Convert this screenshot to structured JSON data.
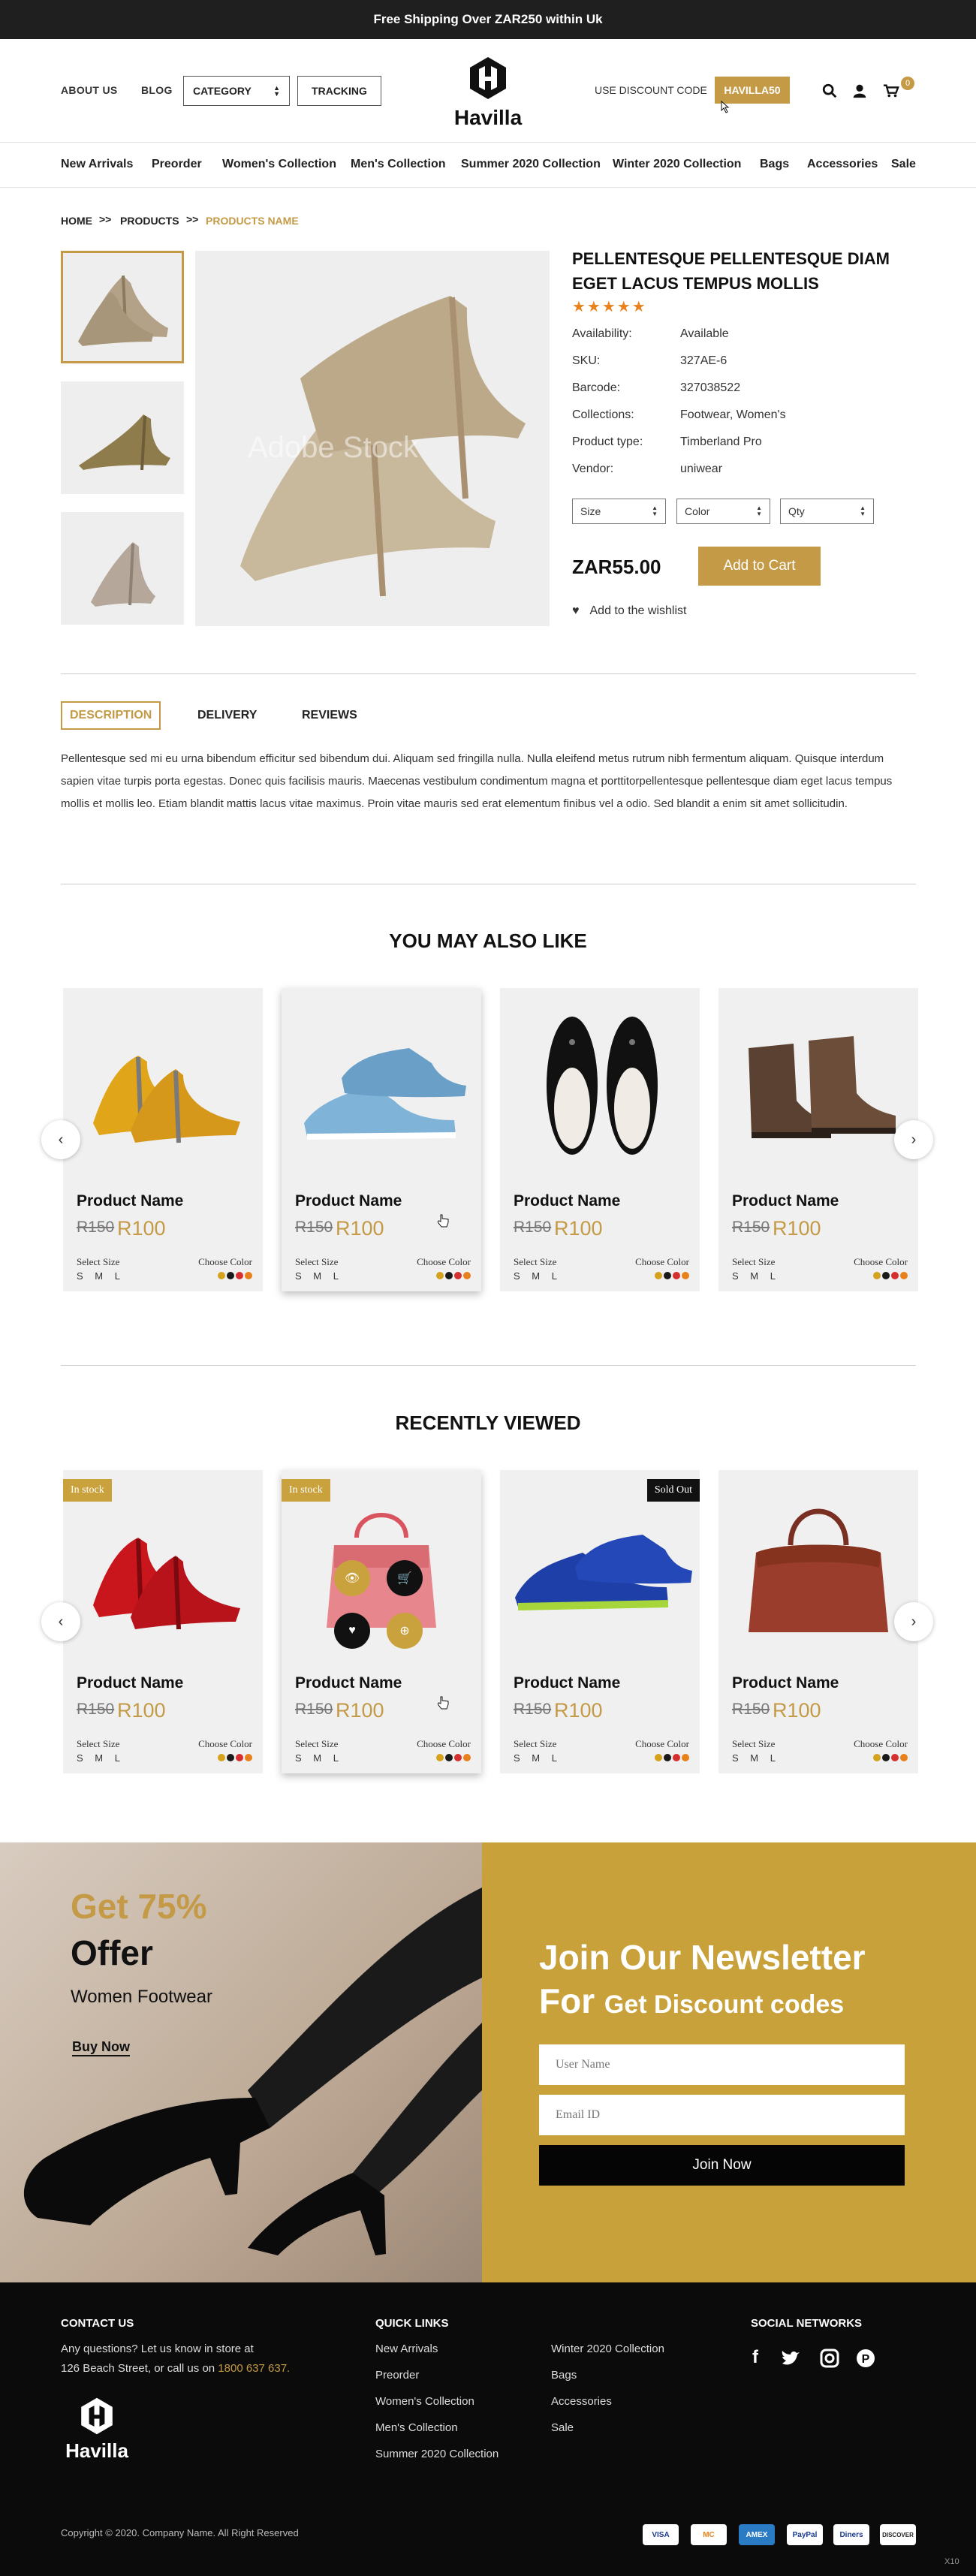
{
  "topbar": {
    "text": "Free Shipping Over ZAR250 within Uk"
  },
  "header": {
    "about": "ABOUT US",
    "blog": "BLOG",
    "category": "CATEGORY",
    "tracking": "TRACKING",
    "logo": "Havilla",
    "discount_label": "USE DISCOUNT CODE",
    "discount_code": "HAVILLA50",
    "cart_count": "0"
  },
  "nav": [
    "New Arrivals",
    "Preorder",
    "Women's Collection",
    "Men's Collection",
    "Summer 2020 Collection",
    "Winter 2020 Collection",
    "Bags",
    "Accessories",
    "Sale"
  ],
  "breadcrumb": {
    "home": "HOME",
    "products": "PRODUCTS",
    "current": "PRODUCTS NAME",
    "sep": ">>"
  },
  "product": {
    "title": "PELLENTESQUE PELLENTESQUE DIAM EGET LACUS TEMPUS MOLLIS",
    "stars": "★★★★★",
    "attrs": [
      {
        "k": "Availability:",
        "v": "Available"
      },
      {
        "k": "SKU:",
        "v": "327AE-6"
      },
      {
        "k": "Barcode:",
        "v": "327038522"
      },
      {
        "k": "Collections:",
        "v": "Footwear, Women's"
      },
      {
        "k": "Product type:",
        "v": "Timberland Pro"
      },
      {
        "k": "Vendor:",
        "v": "uniwear"
      }
    ],
    "size": "Size",
    "color": "Color",
    "qty": "Qty",
    "price": "ZAR55.00",
    "add_to_cart": "Add to Cart",
    "wishlist": "Add to the wishlist",
    "watermark": "Adobe Stock"
  },
  "tabs": {
    "description": "DESCRIPTION",
    "delivery": "DELIVERY",
    "reviews": "REVIEWS"
  },
  "description": "Pellentesque sed mi eu urna bibendum efficitur sed bibendum dui. Aliquam sed fringilla nulla. Nulla eleifend metus rutrum nibh fermentum aliquam. Quisque interdum sapien vitae turpis porta egestas. Donec quis facilisis mauris. Maecenas vestibulum condimentum magna et porttitorpellentesque pellentesque diam eget lacus tempus mollis et mollis leo. Etiam blandit mattis lacus vitae maximus. Proin vitae mauris sed erat elementum finibus vel a odio. Sed blandit a enim sit amet sollicitudin.",
  "also_like": {
    "title": "YOU MAY ALSO LIKE",
    "cards": [
      {
        "name": "Product Name",
        "old": "R150",
        "new": "R100",
        "select_size": "Select Size",
        "sizes": "S M L",
        "choose_color": "Choose Color",
        "image": "yellow-heels"
      },
      {
        "name": "Product Name",
        "old": "R150",
        "new": "R100",
        "select_size": "Select Size",
        "sizes": "S M L",
        "choose_color": "Choose Color",
        "image": "blue-sneakers"
      },
      {
        "name": "Product Name",
        "old": "R150",
        "new": "R100",
        "select_size": "Select Size",
        "sizes": "S M L",
        "choose_color": "Choose Color",
        "image": "black-flats"
      },
      {
        "name": "Product Name",
        "old": "R150",
        "new": "R100",
        "select_size": "Select Size",
        "sizes": "S M L",
        "choose_color": "Choose Color",
        "image": "brown-boots"
      }
    ]
  },
  "recently": {
    "title": "RECENTLY VIEWED",
    "cards": [
      {
        "name": "Product Name",
        "old": "R150",
        "new": "R100",
        "select_size": "Select Size",
        "sizes": "S M L",
        "choose_color": "Choose Color",
        "badge": "In stock",
        "image": "red-heels"
      },
      {
        "name": "Product Name",
        "old": "R150",
        "new": "R100",
        "select_size": "Select Size",
        "sizes": "S M L",
        "choose_color": "Choose Color",
        "badge": "In stock",
        "image": "pink-bag"
      },
      {
        "name": "Product Name",
        "old": "R150",
        "new": "R100",
        "select_size": "Select Size",
        "sizes": "S M L",
        "choose_color": "Choose Color",
        "badge": "Sold Out",
        "image": "blue-sneakers"
      },
      {
        "name": "Product Name",
        "old": "R150",
        "new": "R100",
        "select_size": "Select Size",
        "sizes": "S M L",
        "choose_color": "Choose Color",
        "image": "brown-bag"
      }
    ]
  },
  "color_dots": [
    "#d4a21c",
    "#1a1a1a",
    "#d62f2f",
    "#e8811c"
  ],
  "promo": {
    "get": "Get",
    "pct": "75%",
    "offer": "Offer",
    "sub": "Women Footwear",
    "buy": "Buy Now"
  },
  "newsletter": {
    "line1": "Join Our Newsletter",
    "line2a": "For",
    "line2b": "Get Discount codes",
    "name_ph": "User Name",
    "email_ph": "Email ID",
    "join": "Join Now"
  },
  "footer": {
    "contact_h": "CONTACT US",
    "contact_1": "Any questions? Let us know in store at",
    "contact_2": "126 Beach Street, or call us on",
    "phone": "1800 637 637.",
    "logo": "Havilla",
    "quick_h": "QUICK LINKS",
    "links1": [
      "New Arrivals",
      "Preorder",
      "Women's Collection",
      "Men's Collection",
      "Summer 2020 Collection"
    ],
    "links2": [
      "Winter 2020 Collection",
      "Bags",
      "Accessories",
      "Sale"
    ],
    "social_h": "SOCIAL NETWORKS",
    "copyright": "Copyright © 2020. Company Name. All Right Reserved",
    "payments": [
      "VISA",
      "MC",
      "AMEX",
      "PayPal",
      "Diners",
      "DISCOVER"
    ],
    "corner": "X10"
  },
  "colors": {
    "accent": "#c49a46",
    "dark": "#1f1f1f",
    "promo": "#c8a13a"
  }
}
